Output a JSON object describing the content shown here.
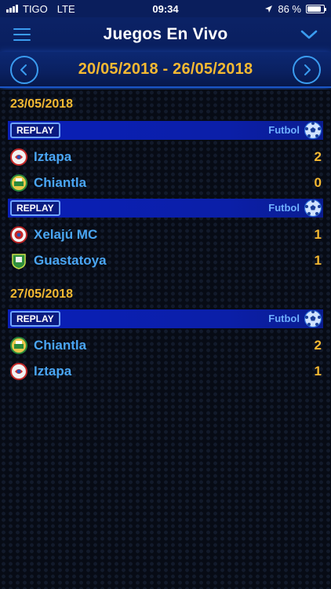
{
  "status_bar": {
    "carrier": "TIGO",
    "network": "LTE",
    "time": "09:34",
    "battery": "86 %",
    "battery_level": 0.86
  },
  "nav": {
    "title": "Juegos En Vivo",
    "menu_icon": "hamburger-menu-icon",
    "dropdown_icon": "chevron-down-icon"
  },
  "date_range": {
    "label": "20/05/2018 - 26/05/2018",
    "prev_icon": "chevron-left-icon",
    "next_icon": "chevron-right-icon"
  },
  "colors": {
    "accent_gold": "#f5b932",
    "team_blue": "#4aa6f4",
    "bar_blue": "#0a1fb8",
    "nav_blue": "#0b2266"
  },
  "days": [
    {
      "date": "23/05/2018",
      "matches": [
        {
          "replay": "REPLAY",
          "sport": "Futbol",
          "home": {
            "name": "Iztapa",
            "score": "2",
            "logo": "iztapa-logo"
          },
          "away": {
            "name": "Chiantla",
            "score": "0",
            "logo": "chiantla-logo"
          }
        },
        {
          "replay": "REPLAY",
          "sport": "Futbol",
          "home": {
            "name": "Xelajú MC",
            "score": "1",
            "logo": "xelaju-logo"
          },
          "away": {
            "name": "Guastatoya",
            "score": "1",
            "logo": "guastatoya-logo"
          }
        }
      ]
    },
    {
      "date": "27/05/2018",
      "matches": [
        {
          "replay": "REPLAY",
          "sport": "Futbol",
          "home": {
            "name": "Chiantla",
            "score": "2",
            "logo": "chiantla-logo"
          },
          "away": {
            "name": "Iztapa",
            "score": "1",
            "logo": "iztapa-logo"
          }
        }
      ]
    }
  ]
}
